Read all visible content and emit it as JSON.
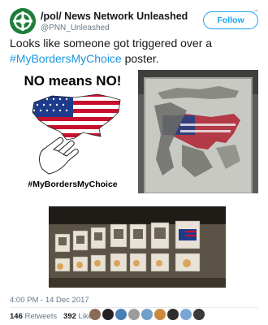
{
  "account": {
    "display_name": "/pol/ News Network Unleashed",
    "handle": "@PNN_Unleashed",
    "follow_label": "Follow"
  },
  "tweet": {
    "text_before": "Looks like someone got triggered over a",
    "hashtag": "#MyBordersMyChoice",
    "text_after": " poster.",
    "timestamp": "4:00 PM - 14 Dec 2017"
  },
  "poster": {
    "title": "NO means NO!",
    "hashtag": "#MyBordersMyChoice"
  },
  "stats": {
    "retweets_count": "146",
    "retweets_label": "Retweets",
    "likes_count": "392",
    "likes_label": "Likes"
  },
  "colors": {
    "accent": "#1da1f2",
    "hashtag": "#1b95e0",
    "avatar": "#1e7a3a"
  },
  "liker_avatars": [
    "#8a6b55",
    "#222222",
    "#4a7fb5",
    "#9c9c9c",
    "#6fa0c9",
    "#c98a3c",
    "#2d2d2d",
    "#7aa6d6",
    "#3a3a3a"
  ]
}
